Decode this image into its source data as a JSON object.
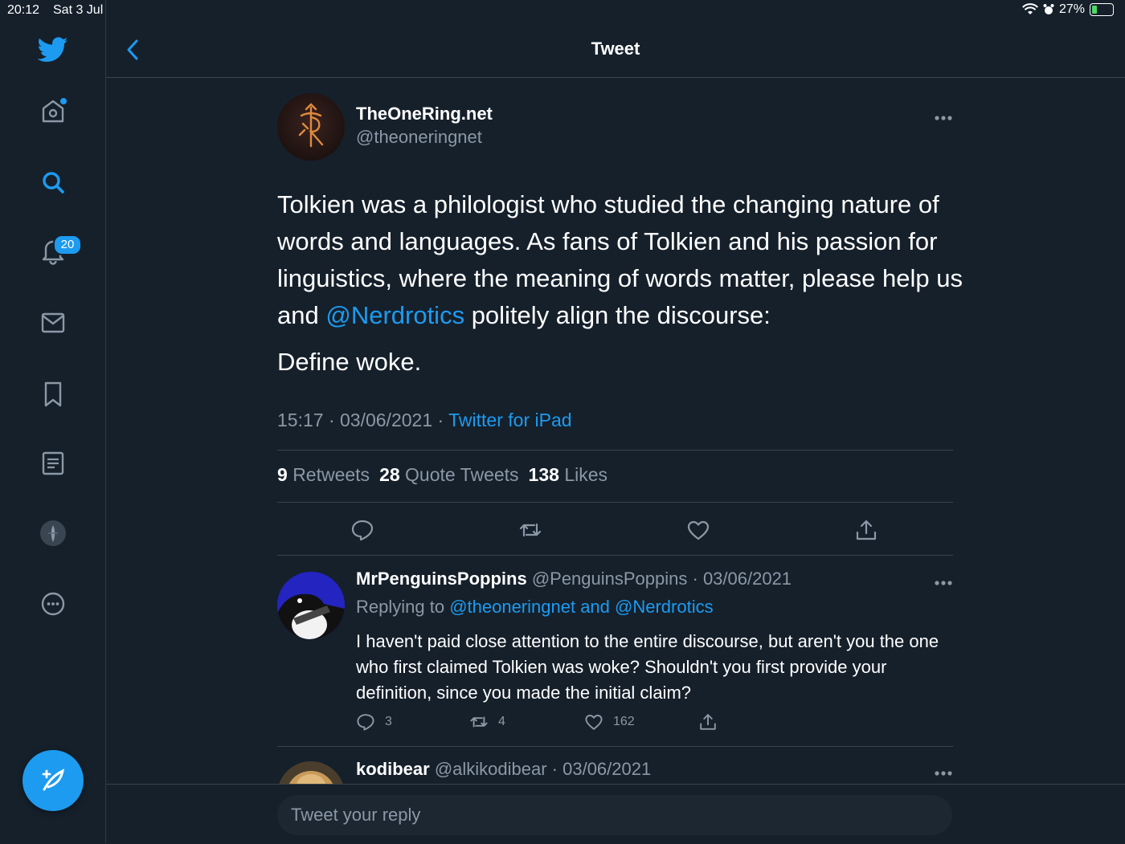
{
  "status_bar": {
    "time": "20:12",
    "date": "Sat 3 Jul",
    "battery": "27%",
    "battery_level": 0.27
  },
  "sidebar": {
    "items": [
      {
        "icon": "twitter-bird-icon"
      },
      {
        "icon": "home-icon"
      },
      {
        "icon": "search-icon"
      },
      {
        "icon": "notifications-bell-icon",
        "badge": "20"
      },
      {
        "icon": "messages-envelope-icon"
      },
      {
        "icon": "bookmark-icon"
      },
      {
        "icon": "lists-icon"
      },
      {
        "icon": "profile-avatar-icon"
      },
      {
        "icon": "more-circle-icon"
      }
    ],
    "compose_icon": "compose-feather-icon"
  },
  "header": {
    "title": "Tweet",
    "back_icon": "chevron-left-icon"
  },
  "tweet": {
    "author": {
      "name": "TheOneRing.net",
      "handle": "@theoneringnet"
    },
    "text_before_mention": "Tolkien was a philologist who studied the changing nature of words and languages. As fans of Tolkien and his passion for linguistics, where the meaning of words matter, please help us and ",
    "mention": "@Nerdrotics",
    "text_after_mention": " politely align the discourse:",
    "text_line2": "Define woke.",
    "timestamp": "15:17 · 03/06/2021 · ",
    "source": "Twitter for iPad",
    "stats": {
      "retweets_count": "9",
      "retweets_label": "Retweets",
      "quotes_count": "28",
      "quotes_label": "Quote Tweets",
      "likes_count": "138",
      "likes_label": "Likes"
    }
  },
  "replies": [
    {
      "name": "MrPenguinsPoppins",
      "handle": "@PenguinsPoppins · 03/06/2021",
      "replying_to_label": "Replying to ",
      "replying_to": "@theoneringnet and @Nerdrotics",
      "text": "I haven't paid close attention to the entire discourse, but aren't you the one who first claimed Tolkien was woke? Shouldn't you first provide your definition, since you made the initial claim?",
      "replies": "3",
      "retweets": "4",
      "likes": "162"
    },
    {
      "name": "kodibear",
      "handle": "@alkikodibear · 03/06/2021"
    }
  ],
  "reply_box": {
    "placeholder": "Tweet your reply"
  },
  "colors": {
    "background": "#15202b",
    "accent": "#1d9bf0",
    "secondary_text": "#8b98a5",
    "divider": "#38444d"
  }
}
